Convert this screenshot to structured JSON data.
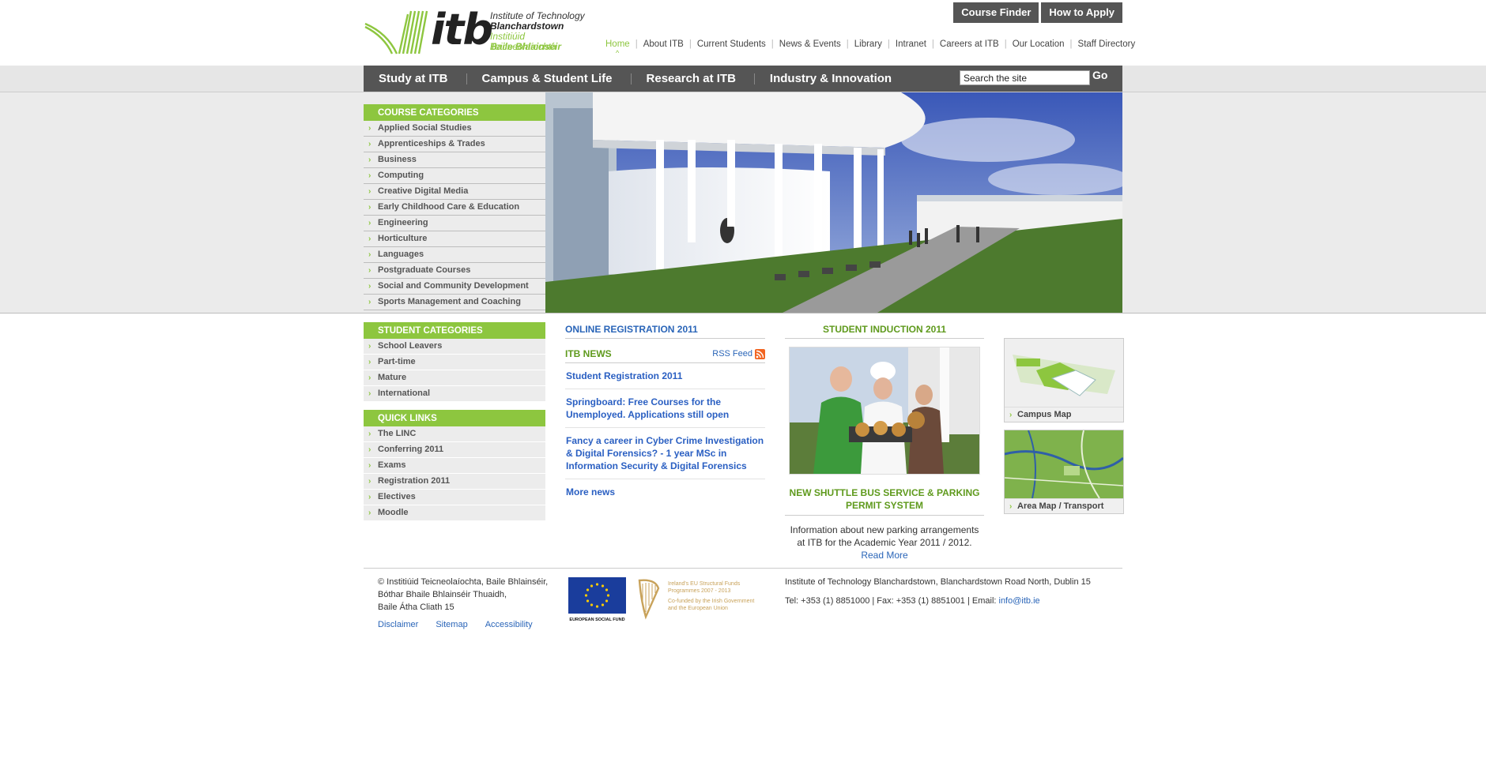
{
  "header": {
    "logo": {
      "wordmark": "itb",
      "line1": "Institute of Technology",
      "line2": "Blanchardstown",
      "line3": "Institiúid Teicneolaíochta",
      "line4": "Baile Bhlainséir"
    },
    "top_buttons": {
      "course_finder": "Course Finder",
      "how_to_apply": "How to Apply"
    },
    "top_nav": [
      "Home",
      "About ITB",
      "Current Students",
      "News & Events",
      "Library",
      "Intranet",
      "Careers at ITB",
      "Our Location",
      "Staff Directory"
    ],
    "active_top_nav": "Home",
    "caret": "^"
  },
  "main_nav": {
    "items": [
      "Study at ITB",
      "Campus & Student Life",
      "Research at ITB",
      "Industry & Innovation"
    ],
    "search_value": "Search the site",
    "go_label": "Go"
  },
  "course_categories": {
    "heading": "COURSE CATEGORIES",
    "items": [
      "Applied Social Studies",
      "Apprenticeships & Trades",
      "Business",
      "Computing",
      "Creative Digital Media",
      "Early Childhood Care & Education",
      "Engineering",
      "Horticulture",
      "Languages",
      "Postgraduate Courses",
      "Social and Community Development",
      "Sports Management and Coaching"
    ]
  },
  "student_categories": {
    "heading": "STUDENT CATEGORIES",
    "items": [
      "School Leavers",
      "Part-time",
      "Mature",
      "International"
    ]
  },
  "quick_links": {
    "heading": "QUICK LINKS",
    "items": [
      "The LINC",
      "Conferring 2011",
      "Exams",
      "Registration 2011",
      "Electives",
      "Moodle"
    ]
  },
  "middle": {
    "online_registration": "ONLINE REGISTRATION 2011",
    "news_heading": "ITB NEWS",
    "rss_label": "RSS Feed",
    "news": [
      "Student Registration 2011",
      "Springboard: Free Courses for the Unemployed. Applications still open",
      "Fancy a career in Cyber Crime Investigation & Digital Forensics? - 1 year MSc in Information Security & Digital Forensics"
    ],
    "more_news": "More news"
  },
  "induction": {
    "heading": "STUDENT INDUCTION 2011",
    "subheading": "NEW SHUTTLE BUS SERVICE & PARKING PERMIT SYSTEM",
    "body": "Information about new parking arrangements at ITB for the Academic Year 2011 / 2012.",
    "read_more": "Read More"
  },
  "right": {
    "campus_map": "Campus Map",
    "area_map": "Area Map / Transport"
  },
  "footer": {
    "address_lines": [
      "© Institiúid Teicneolaíochta, Baile Bhlainséir,",
      "Bóthar Bhaile Bhlainséir Thuaidh,",
      "Baile Átha Cliath 15"
    ],
    "links": [
      "Disclaimer",
      "Sitemap",
      "Accessibility"
    ],
    "esf_label": "EUROPEAN SOCIAL FUND",
    "eu_funds_lines": [
      "Ireland's EU Structural Funds",
      "Programmes 2007 - 2013",
      "Co-funded by the Irish Government",
      "and the European Union"
    ],
    "institute_address": "Institute of Technology Blanchardstown, Blanchardstown Road North, Dublin 15",
    "contact_prefix": "Tel: +353 (1) 8851000 | Fax: +353 (1) 8851001 | Email: ",
    "email": "info@itb.ie"
  },
  "colors": {
    "brand_green": "#8dc63f",
    "nav_grey": "#555555",
    "link_blue": "#2a65b8"
  }
}
